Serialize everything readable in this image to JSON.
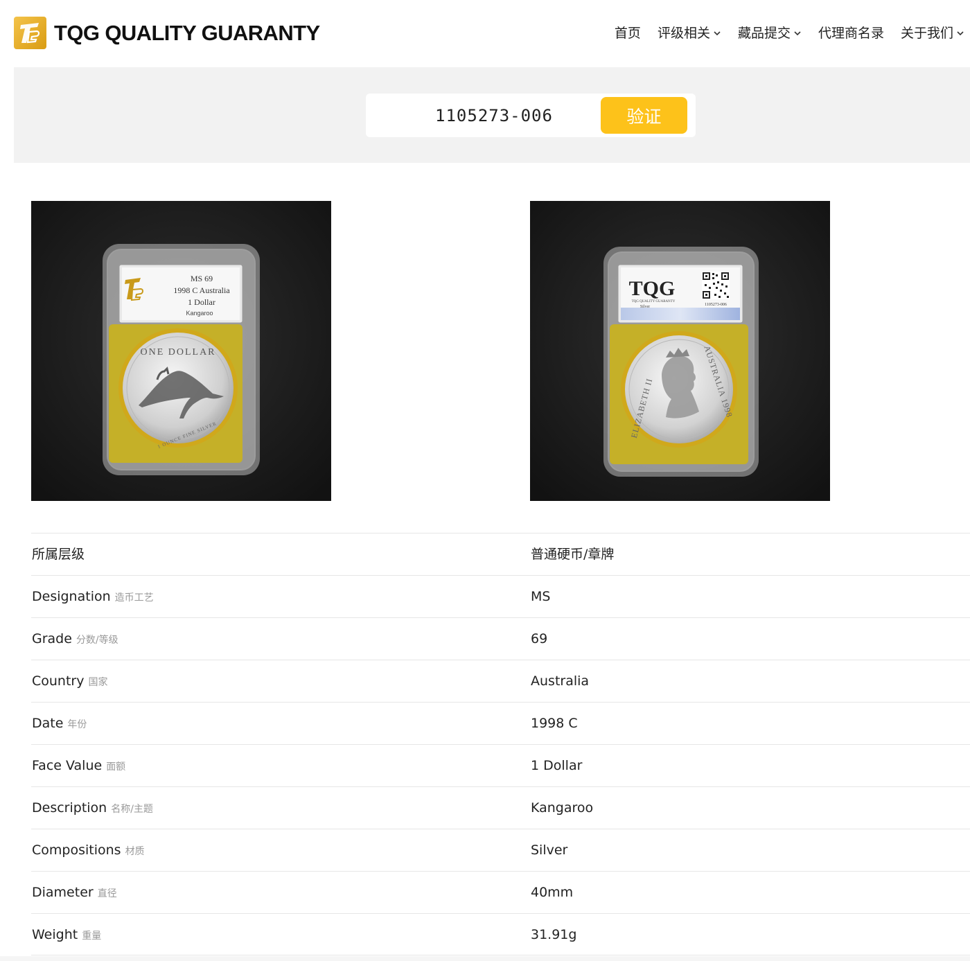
{
  "header": {
    "brand": "TQG QUALITY GUARANTY",
    "nav": [
      {
        "label": "首页",
        "has_dropdown": false
      },
      {
        "label": "评级相关",
        "has_dropdown": true
      },
      {
        "label": "藏品提交",
        "has_dropdown": true
      },
      {
        "label": "代理商名录",
        "has_dropdown": false
      },
      {
        "label": "关于我们",
        "has_dropdown": true
      }
    ]
  },
  "search": {
    "value": "1105273-006",
    "button_label": "验证"
  },
  "images": {
    "obverse_slab": {
      "grade_line": "MS 69",
      "year_line": "1998 C Australia",
      "value_line": "1 Dollar",
      "desc_line": "Kangaroo",
      "coin_top": "ONE DOLLAR",
      "coin_bottom": "1 OUNCE FINE SILVER"
    },
    "reverse_slab": {
      "logo": "TQG",
      "logo_sub": "TQG QUALITY GUARANTY",
      "material": "Silver",
      "cert_number": "1105273-006",
      "coin_left": "ELIZABETH II",
      "coin_right": "AUSTRALIA 1998"
    }
  },
  "specs": {
    "rows": [
      {
        "label": "所属层级",
        "sub": "",
        "value": "普通硬币/章牌"
      },
      {
        "label": "Designation",
        "sub": "造币工艺",
        "value": "MS"
      },
      {
        "label": "Grade",
        "sub": "分数/等级",
        "value": "69"
      },
      {
        "label": "Country",
        "sub": "国家",
        "value": "Australia"
      },
      {
        "label": "Date",
        "sub": "年份",
        "value": "1998 C"
      },
      {
        "label": "Face Value",
        "sub": "面额",
        "value": "1 Dollar"
      },
      {
        "label": "Description",
        "sub": "名称/主题",
        "value": "Kangaroo"
      },
      {
        "label": "Compositions",
        "sub": "材质",
        "value": "Silver"
      },
      {
        "label": "Diameter",
        "sub": "直径",
        "value": "40mm"
      },
      {
        "label": "Weight",
        "sub": "重量",
        "value": "31.91g"
      }
    ]
  },
  "colors": {
    "accent": "#fdc21a",
    "band": "#f2f2f2",
    "slab_insert": "#c9b21e"
  }
}
